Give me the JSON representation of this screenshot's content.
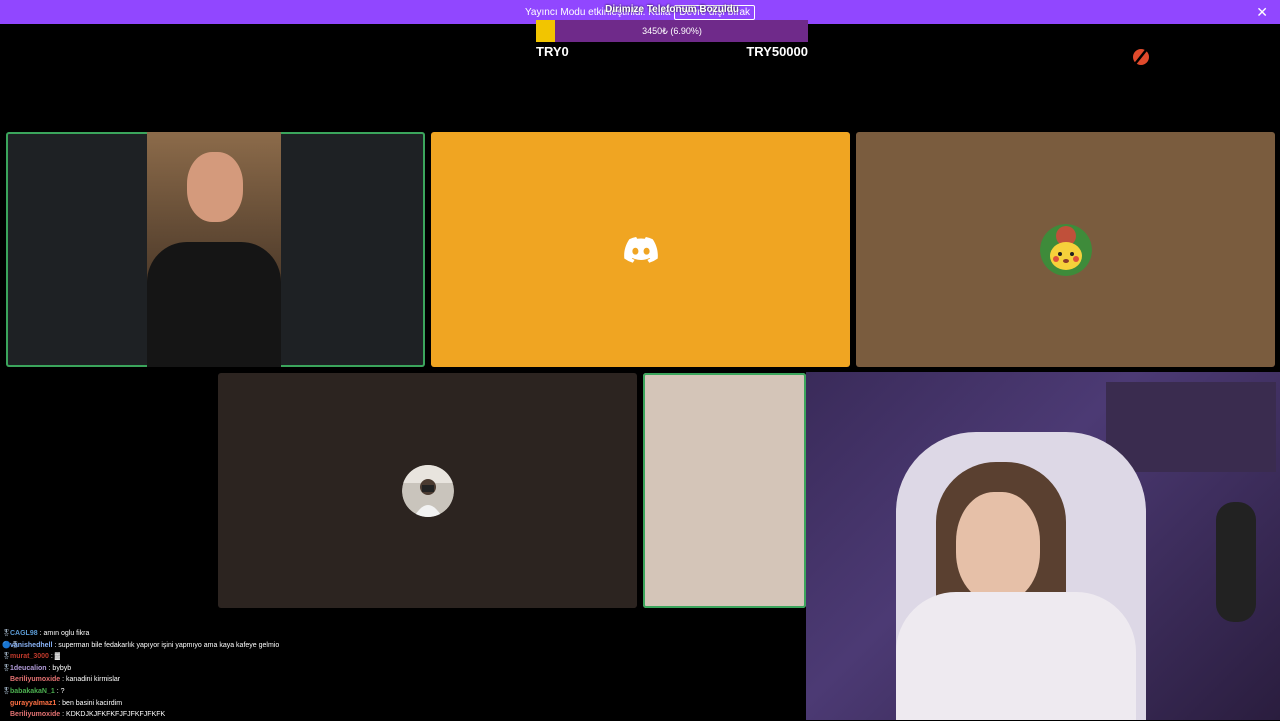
{
  "banner": {
    "text": "Yayıncı Modu etkinleştirildi. Kulla",
    "button_label": "Devre dışı bırak",
    "close_icon": "close-icon"
  },
  "goal": {
    "title": "Dirimize Telefonum Bozuldu",
    "progress_text": "3450₺ (6.90%)",
    "progress_fraction": 0.069,
    "min_label": "TRY0",
    "max_label": "TRY50000",
    "fill_color": "#f2c500",
    "bar_color": "#6f2a8a"
  },
  "tiles": [
    {
      "name": "camera-participant",
      "type": "video",
      "background": "#1e2124",
      "speaking": true
    },
    {
      "name": "discord-participant",
      "type": "discord-logo",
      "background": "#f0a522",
      "speaking": false
    },
    {
      "name": "pikachu-participant",
      "type": "avatar",
      "background": "#7a5c3e",
      "speaking": false
    },
    {
      "name": "photo-participant",
      "type": "avatar",
      "background": "#2c2420",
      "speaking": false
    },
    {
      "name": "beige-participant",
      "type": "blank",
      "background": "#d4c5b8",
      "speaking": true
    }
  ],
  "chat": [
    {
      "badge": "🎖",
      "user": "CAGL98",
      "user_color": "#5b9bd5",
      "message": "amın oglu fikra"
    },
    {
      "badge": "🔵🎖",
      "user": "vanishedhell",
      "user_color": "#8ab4f8",
      "message": "superman bile fedakarlık yapıyor işini yapmıyo ama kaya kafeye gelmio"
    },
    {
      "badge": "🎖",
      "user": "murat_3000",
      "user_color": "#c0392b",
      "message": "▓"
    },
    {
      "badge": "🎖",
      "user": "1deucalion",
      "user_color": "#b39ddb",
      "message": "bybyb"
    },
    {
      "badge": "",
      "user": "Beriliyumoxide",
      "user_color": "#e57373",
      "message": "kanadini kirmislar"
    },
    {
      "badge": "🎖",
      "user": "babakakaN_1",
      "user_color": "#4caf50",
      "message": "?"
    },
    {
      "badge": "",
      "user": "gurayyalmaz1",
      "user_color": "#ff7043",
      "message": "ben basini kacirdim"
    },
    {
      "badge": "",
      "user": "Beriliyumoxide",
      "user_color": "#e57373",
      "message": "KDKDJKJFKFKFJFJFKFJFKFK"
    }
  ]
}
